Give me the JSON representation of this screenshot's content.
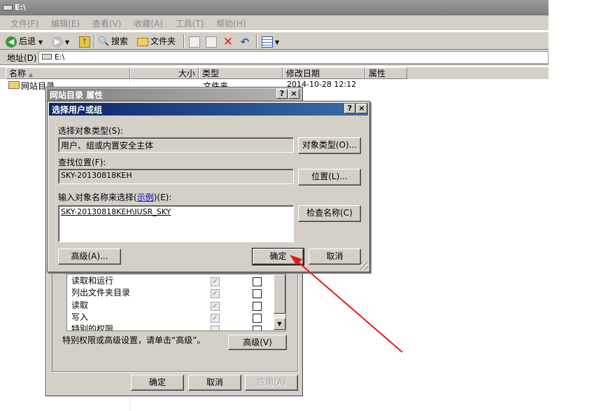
{
  "explorer": {
    "title": "E:\\",
    "menu": [
      {
        "label": "文件(F)"
      },
      {
        "label": "编辑(E)"
      },
      {
        "label": "查看(V)"
      },
      {
        "label": "收藏(A)"
      },
      {
        "label": "工具(T)"
      },
      {
        "label": "帮助(H)"
      }
    ],
    "toolbar": {
      "back_label": "后退",
      "search_label": "搜索",
      "folders_label": "文件夹"
    },
    "address": {
      "label": "地址(D)",
      "value": "E:\\"
    },
    "columns": [
      "名称",
      "大小",
      "类型",
      "修改日期",
      "属性"
    ],
    "rows": [
      {
        "name": "网站目录",
        "type": "文件夹",
        "modified": "2014-10-28 12:12"
      }
    ]
  },
  "properties_dialog": {
    "title": "网站目录 属性",
    "permissions": [
      {
        "name": "读取和运行",
        "allow": true,
        "deny": false
      },
      {
        "name": "列出文件夹目录",
        "allow": true,
        "deny": false
      },
      {
        "name": "读取",
        "allow": true,
        "deny": false
      },
      {
        "name": "写入",
        "allow": true,
        "deny": false
      },
      {
        "name": "特别的权限",
        "allow": false,
        "deny": false
      }
    ],
    "special_hint": "特别权限或高级设置，请单击“高级”。",
    "advanced_label": "高级(V)",
    "ok_label": "确定",
    "cancel_label": "取消",
    "apply_label": "应用(A)"
  },
  "select_users_dialog": {
    "title": "选择用户或组",
    "object_type_label": "选择对象类型(S):",
    "object_type_value": "用户、组或内置安全主体",
    "object_types_button": "对象类型(O)...",
    "location_label": "查找位置(F):",
    "location_value": "SKY-20130818KEH",
    "locations_button": "位置(L)...",
    "enter_names_label_prefix": "输入对象名称来选择(",
    "enter_names_link": "示例",
    "enter_names_label_suffix": ")(E):",
    "enter_names_value": "SKY-20130818KEH\\IUSR_SKY",
    "check_names_button": "检查名称(C)",
    "advanced_button": "高级(A)...",
    "ok_button": "确定",
    "cancel_button": "取消"
  },
  "caption_buttons": {
    "help": "?",
    "close": "×"
  },
  "colors": {
    "active_title": "#0a246a",
    "inactive_title": "#808080",
    "dialog_face": "#d4d0c8",
    "annotation_arrow": "#e8161b"
  }
}
